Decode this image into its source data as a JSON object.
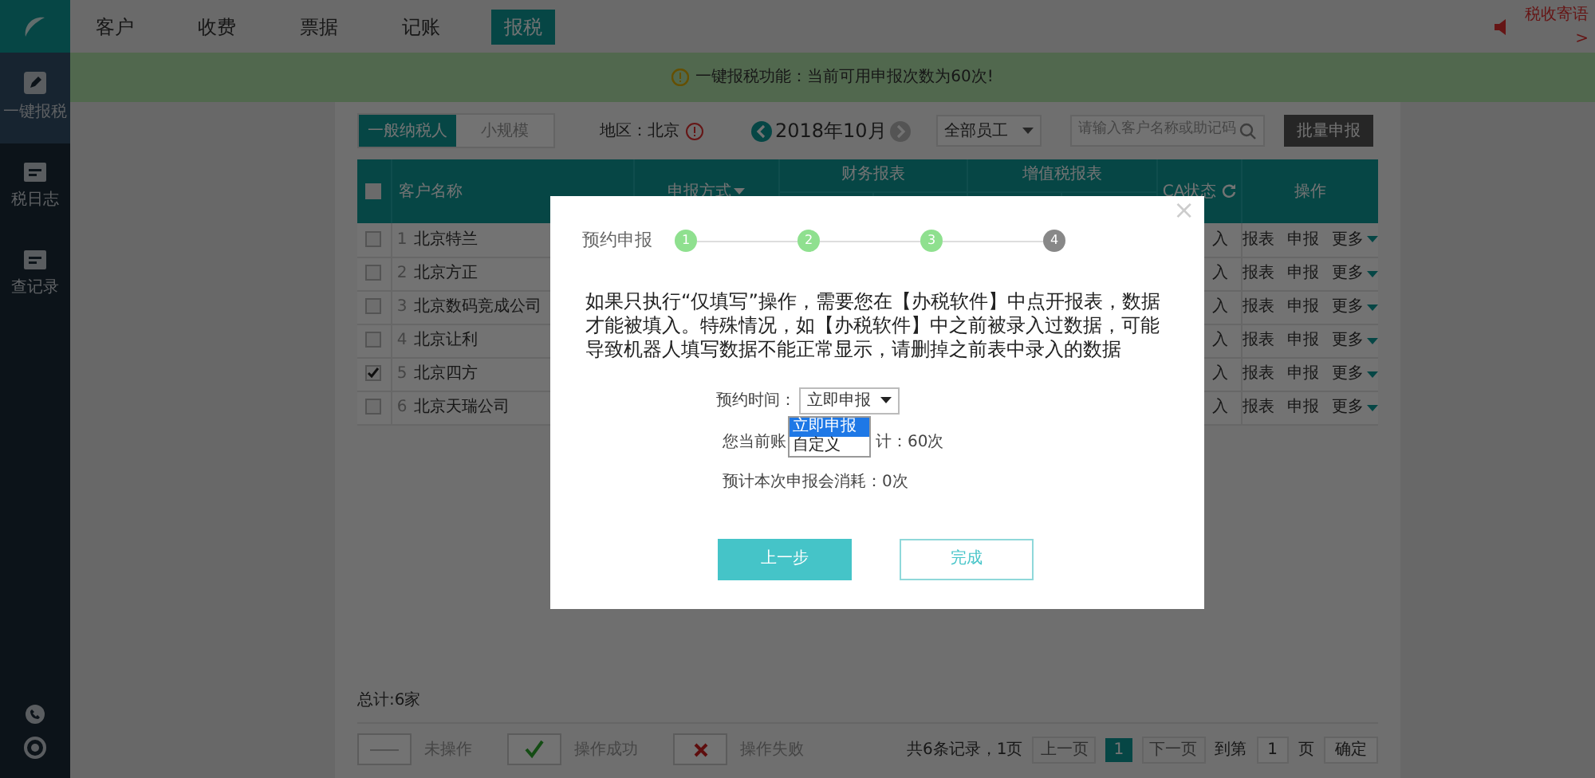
{
  "sidebar": {
    "items": [
      {
        "label": "一键报税",
        "kind": "pen",
        "selected": true
      },
      {
        "label": "税日志",
        "kind": "card",
        "selected": false
      },
      {
        "label": "查记录",
        "kind": "card",
        "selected": false
      }
    ]
  },
  "top_nav": [
    {
      "label": "客户",
      "selected": false
    },
    {
      "label": "收费",
      "selected": false
    },
    {
      "label": "票据",
      "selected": false
    },
    {
      "label": "记账",
      "selected": false
    },
    {
      "label": "报税",
      "selected": true
    }
  ],
  "top_right": {
    "title": "税收寄语",
    "more": ">"
  },
  "notice": "一键报税功能：当前可用申报次数为60次!",
  "taxpayer_tabs": [
    {
      "label": "一般纳税人",
      "selected": true
    },
    {
      "label": "小规模",
      "selected": false
    }
  ],
  "region": "地区：北京",
  "month": "2018年10月",
  "staff_select": "全部员工",
  "search": {
    "placeholder": "请输入客户名称或助记码"
  },
  "batch_button": "批量申报",
  "table": {
    "columns": {
      "name": "客户名称",
      "method": "申报方式",
      "finance": "财务报表",
      "vat": "增值税报表",
      "ca": "CA状态",
      "ops": "操作"
    },
    "all_checked": false,
    "rows": [
      {
        "index": "1",
        "name": "北京特兰",
        "checked": false,
        "ca": "入",
        "ops": [
          "报表",
          "申报",
          "更多"
        ]
      },
      {
        "index": "2",
        "name": "北京方正",
        "checked": false,
        "ca": "入",
        "ops": [
          "报表",
          "申报",
          "更多"
        ]
      },
      {
        "index": "3",
        "name": "北京数码竞成公司",
        "checked": false,
        "ca": "入",
        "ops": [
          "报表",
          "申报",
          "更多"
        ]
      },
      {
        "index": "4",
        "name": "北京让利",
        "checked": false,
        "ca": "入",
        "ops": [
          "报表",
          "申报",
          "更多"
        ]
      },
      {
        "index": "5",
        "name": "北京四方",
        "checked": true,
        "ca": "入",
        "ops": [
          "报表",
          "申报",
          "更多"
        ]
      },
      {
        "index": "6",
        "name": "北京天瑞公司",
        "checked": false,
        "ca": "入",
        "ops": [
          "报表",
          "申报",
          "更多"
        ]
      }
    ]
  },
  "total": "总计:6家",
  "legend": [
    {
      "kind": "none",
      "label": "未操作"
    },
    {
      "kind": "success",
      "label": "操作成功"
    },
    {
      "kind": "fail",
      "label": "操作失败"
    }
  ],
  "pagination": {
    "summary": "共6条记录，1页",
    "prev": "上一页",
    "pages": [
      {
        "label": "1",
        "selected": true
      }
    ],
    "next": "下一页",
    "goto": "到第",
    "page_input": "1",
    "page_unit": "页",
    "confirm": "确定"
  },
  "modal": {
    "title": "预约申报",
    "steps": [
      {
        "label": "1",
        "done": true
      },
      {
        "label": "2",
        "done": true
      },
      {
        "label": "3",
        "done": true
      },
      {
        "label": "4",
        "done": false
      }
    ],
    "message": "如果只执行“仅填写”操作，需要您在【办税软件】中点开报表，数据才能被填入。特殊情况，如【办税软件】中之前被录入过数据，可能导致机器人填写数据不能正常显示，请删掉之前表中录入的数据",
    "time_label": "预约时间：",
    "time_value": "立即申报",
    "options": [
      {
        "label": "立即申报",
        "selected": true
      },
      {
        "label": "自定义",
        "selected": false
      }
    ],
    "remaining_start": "您当前账",
    "remaining_end": "计：60次",
    "consume": "预计本次申报会消耗：0次",
    "prev_button": "上一步",
    "finish_button": "完成",
    "close": "×"
  }
}
